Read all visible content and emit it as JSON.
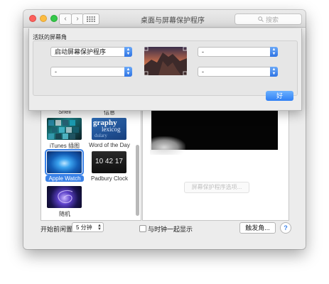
{
  "window": {
    "title": "桌面与屏幕保护程序",
    "search_placeholder": "搜索"
  },
  "sheet": {
    "section_label": "活跃的屏幕角",
    "corners": {
      "top_left": "启动屏幕保护程序",
      "top_right": "-",
      "bottom_left": "-",
      "bottom_right": "-"
    },
    "ok_label": "好"
  },
  "screensavers": {
    "items": [
      {
        "label": "Shell"
      },
      {
        "label": "信息"
      },
      {
        "label": "iTunes 插图"
      },
      {
        "label": "Word of the Day"
      },
      {
        "label": "Apple Watch",
        "selected": true
      },
      {
        "label": "Padbury Clock"
      },
      {
        "label": "随机"
      }
    ],
    "word_thumb_text": [
      "graphy",
      "lexicog",
      "dulary"
    ],
    "clock_thumb_text": "10 42 17"
  },
  "preview": {
    "options_button": "屏幕保护程序选项..."
  },
  "footer": {
    "start_label": "开始前闲置:",
    "start_value": "5 分钟",
    "show_clock_label": "与时钟一起显示",
    "hot_corners_label": "触发角...",
    "help_label": "?"
  },
  "colors": {
    "accent": "#3a82e8",
    "window_bg": "#ececec"
  }
}
